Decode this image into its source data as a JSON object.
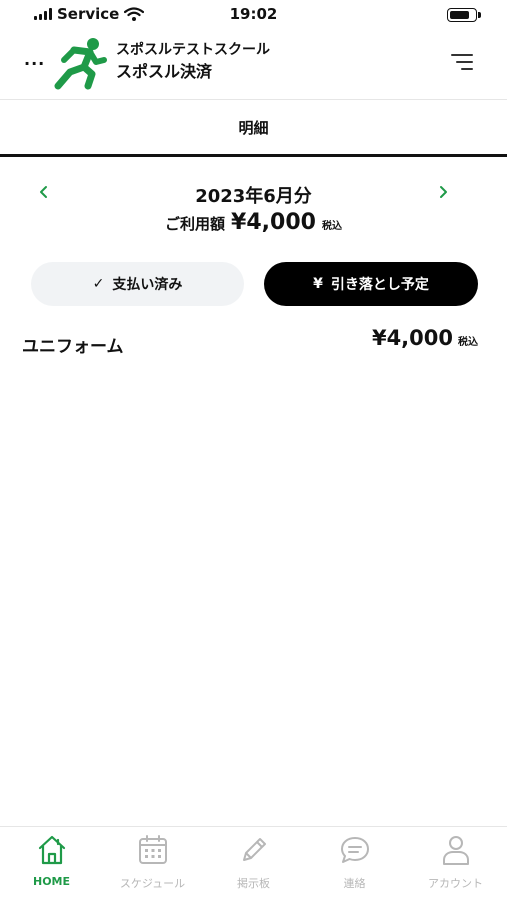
{
  "status_bar": {
    "carrier": "Service",
    "time": "19:02"
  },
  "header": {
    "more_label": "...",
    "school_name": "スポスルテストスクール",
    "app_name": "スポスル決済",
    "logo_icon": "running-man-icon",
    "menu_icon": "menu-lines-icon",
    "brand_color": "#1f9a48"
  },
  "page": {
    "title": "明細"
  },
  "month_nav": {
    "month_label": "2023年6月分",
    "usage_label": "ご利用額",
    "usage_amount": "¥4,000",
    "tax_label": "税込"
  },
  "buttons": {
    "paid": {
      "icon": "✓",
      "label": "支払い済み"
    },
    "planned": {
      "icon": "¥",
      "label": "引き落とし予定"
    }
  },
  "items": [
    {
      "name": "ユニフォーム",
      "price": "¥4,000",
      "tax": "税込"
    }
  ],
  "bottom_nav": [
    {
      "label": "HOME",
      "icon": "home-icon",
      "active": true
    },
    {
      "label": "スケジュール",
      "icon": "calendar-icon",
      "active": false
    },
    {
      "label": "掲示板",
      "icon": "pencil-icon",
      "active": false
    },
    {
      "label": "連絡",
      "icon": "chat-bubble-icon",
      "active": false
    },
    {
      "label": "アカウント",
      "icon": "person-icon",
      "active": false
    }
  ]
}
